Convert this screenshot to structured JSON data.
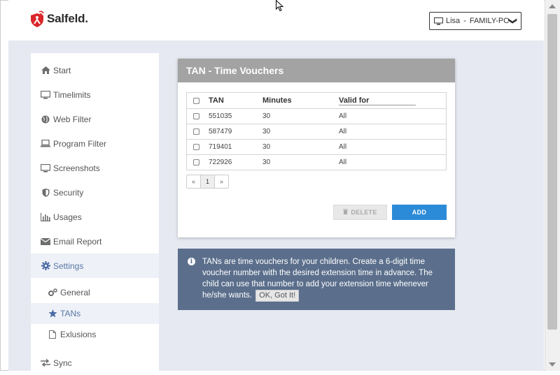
{
  "brand": {
    "name": "Salfeld."
  },
  "user_select": {
    "user": "Lisa",
    "separator": "-",
    "computer": "FAMILY-PC",
    "chevron": "❯"
  },
  "sidebar": {
    "items": [
      {
        "label": "Start",
        "icon": "home-icon"
      },
      {
        "label": "Timelimits",
        "icon": "monitor-icon"
      },
      {
        "label": "Web Filter",
        "icon": "globe-icon"
      },
      {
        "label": "Program Filter",
        "icon": "laptop-icon"
      },
      {
        "label": "Screenshots",
        "icon": "monitor-icon"
      },
      {
        "label": "Security",
        "icon": "shield-icon"
      },
      {
        "label": "Usages",
        "icon": "bar-chart-icon"
      },
      {
        "label": "Email Report",
        "icon": "envelope-icon"
      },
      {
        "label": "Settings",
        "icon": "gear-icon"
      }
    ],
    "subitems": [
      {
        "label": "General",
        "icon": "gears-icon"
      },
      {
        "label": "TANs",
        "icon": "star-icon"
      },
      {
        "label": "Exlusions",
        "icon": "file-icon"
      }
    ],
    "sync": {
      "label": "Sync",
      "icon": "exchange-icon"
    }
  },
  "card": {
    "title": "TAN - Time Vouchers",
    "columns": [
      "TAN",
      "Minutes",
      "Valid for"
    ],
    "rows": [
      {
        "tan": "551035",
        "minutes": "30",
        "valid_for": "All"
      },
      {
        "tan": "587479",
        "minutes": "30",
        "valid_for": "All"
      },
      {
        "tan": "719401",
        "minutes": "30",
        "valid_for": "All"
      },
      {
        "tan": "722926",
        "minutes": "30",
        "valid_for": "All"
      }
    ],
    "pagination": {
      "prev": "«",
      "current": "1",
      "next": "»"
    },
    "delete_label": "DELETE",
    "add_label": "ADD"
  },
  "info": {
    "text": "TANs are time vouchers for your children. Create a 6-digit time voucher number with the desired extension time in advance. The child can use that number to add your extension time whenever he/she wants.",
    "ok_label": "OK, Got It!"
  },
  "colors": {
    "accent": "#2c8bd8",
    "card_header": "#a3a3a3",
    "info_bg": "#5b6f8c",
    "brand_red": "#d9262a"
  }
}
